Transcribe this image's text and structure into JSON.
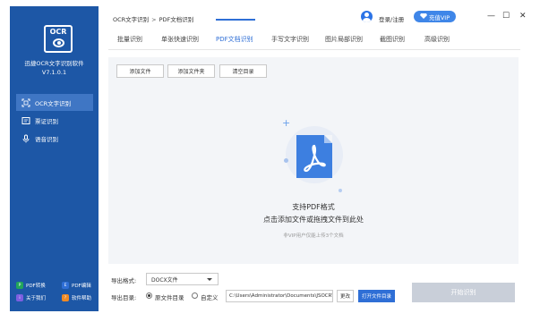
{
  "sidebar": {
    "logo_text": "OCR",
    "app_name": "迅捷OCR文字识别软件",
    "version": "V7.1.0.1",
    "items": [
      {
        "label": "OCR文字识别",
        "icon": "scan-icon",
        "active": true
      },
      {
        "label": "票证识别",
        "icon": "ticket-icon",
        "active": false
      },
      {
        "label": "语音识别",
        "icon": "microphone-icon",
        "active": false
      }
    ],
    "links": [
      {
        "label": "PDF转换",
        "icon": "pdf-convert-icon",
        "color": "#22a55a"
      },
      {
        "label": "PDF编辑",
        "icon": "pdf-edit-icon",
        "color": "#2f6fd6"
      },
      {
        "label": "关于我们",
        "icon": "about-icon",
        "color": "#7d5fe0"
      },
      {
        "label": "软件帮助",
        "icon": "help-icon",
        "color": "#f08a24"
      }
    ]
  },
  "header": {
    "crumb_root": "OCR文字识别",
    "crumb_sep": ">",
    "crumb_current": "PDF文档识别",
    "login": "登录/注册",
    "vip": "充值VIP"
  },
  "window_controls": {
    "minimize": "—",
    "maximize": "☐",
    "close": "✕"
  },
  "tabs": [
    {
      "label": "批量识别"
    },
    {
      "label": "单张快速识别"
    },
    {
      "label": "PDF文档识别",
      "active": true
    },
    {
      "label": "手写文字识别"
    },
    {
      "label": "图片局部识别"
    },
    {
      "label": "截图识别"
    },
    {
      "label": "高级识别"
    }
  ],
  "toolbar": {
    "add_file": "添加文件",
    "add_folder": "添加文件夹",
    "clear": "清空目录"
  },
  "dropzone": {
    "plus": "+",
    "support": "支持PDF格式",
    "hint": "点击添加文件或拖拽文件到此处",
    "limit": "非VIP用户仅能上传3个文档"
  },
  "export": {
    "format_label": "导出格式:",
    "format_value": "DOCX文件",
    "dir_label": "导出目录:",
    "option_source": "原文件目录",
    "option_custom": "自定义",
    "path": "C:\\Users\\Administrator\\Documents\\JSOCR\\",
    "change": "更改",
    "open": "打开文件目录",
    "start": "开始识别"
  }
}
